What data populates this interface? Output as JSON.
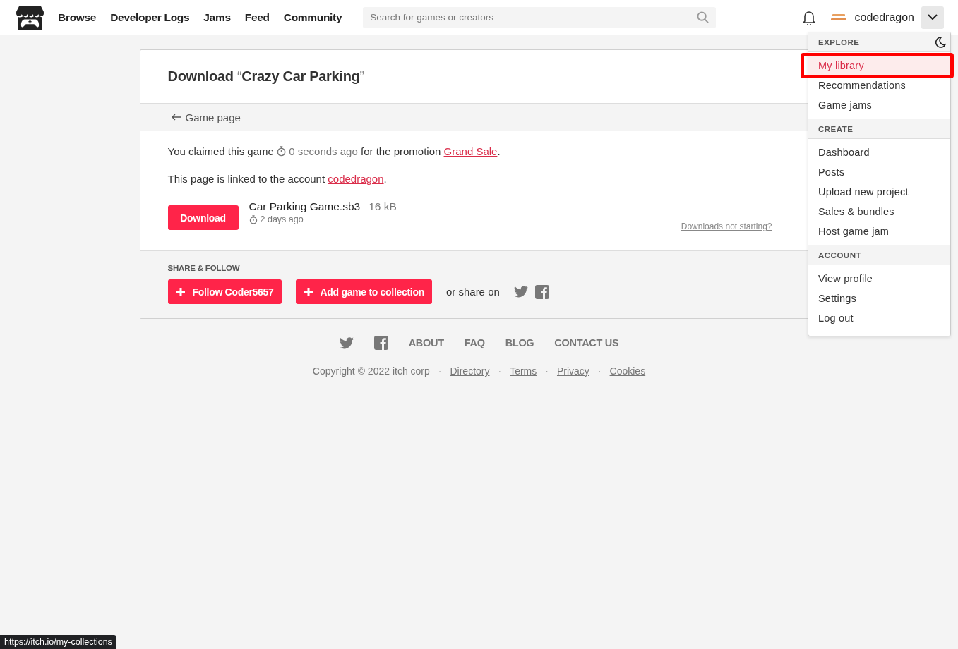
{
  "header": {
    "nav": [
      "Browse",
      "Developer Logs",
      "Jams",
      "Feed",
      "Community"
    ],
    "search": {
      "placeholder": "Search for games or creators"
    },
    "username": "codedragon"
  },
  "menu": {
    "sections": [
      {
        "title": "EXPLORE",
        "items": [
          {
            "label": "My library",
            "selected": true,
            "outlined": true
          },
          {
            "label": "Recommendations",
            "selected": false,
            "outlined": false
          },
          {
            "label": "Game jams",
            "selected": false,
            "outlined": false
          }
        ]
      },
      {
        "title": "CREATE",
        "items": [
          {
            "label": "Dashboard",
            "selected": false,
            "outlined": false
          },
          {
            "label": "Posts",
            "selected": false,
            "outlined": false
          },
          {
            "label": "Upload new project",
            "selected": false,
            "outlined": false
          },
          {
            "label": "Sales & bundles",
            "selected": false,
            "outlined": false
          },
          {
            "label": "Host game jam",
            "selected": false,
            "outlined": false
          }
        ]
      },
      {
        "title": "ACCOUNT",
        "items": [
          {
            "label": "View profile",
            "selected": false,
            "outlined": false
          },
          {
            "label": "Settings",
            "selected": false,
            "outlined": false
          },
          {
            "label": "Log out",
            "selected": false,
            "outlined": false
          }
        ]
      }
    ]
  },
  "card": {
    "title": [
      {
        "text": "Download ",
        "kind": "plain"
      },
      {
        "text": "“",
        "kind": "quote"
      },
      {
        "text": "Crazy Car Parking",
        "kind": "plain"
      },
      {
        "text": "”",
        "kind": "quote"
      }
    ],
    "back_link": "Game page",
    "claim": {
      "before": "You claimed this game",
      "time": "0 seconds ago",
      "middle": "for the promotion",
      "link": "Grand Sale",
      "after": "."
    },
    "account": {
      "before": "This page is linked to the account",
      "link": "codedragon",
      "after": "."
    },
    "file": {
      "button": "Download",
      "name": "Car Parking Game.sb3",
      "size": "16 kB",
      "date": "2 days ago",
      "help": "Downloads not starting?"
    },
    "share": {
      "heading": "SHARE & FOLLOW",
      "buttons": [
        "Follow Coder5657",
        "Add game to collection"
      ],
      "share_text": "or share on"
    }
  },
  "footer": {
    "links": [
      "ABOUT",
      "FAQ",
      "BLOG",
      "CONTACT US"
    ],
    "copyright": "Copyright © 2022 itch corp",
    "legal": [
      "Directory",
      "Terms",
      "Privacy",
      "Cookies"
    ],
    "separator": "·"
  },
  "status_url": "https://itch.io/my-collections"
}
